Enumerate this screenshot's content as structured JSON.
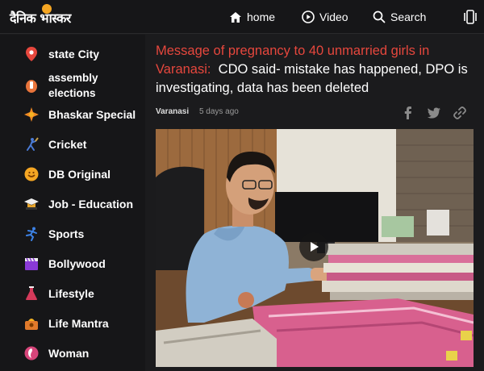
{
  "brand": {
    "logo_text": "दैनिक भास्कर"
  },
  "topnav": {
    "home": "home",
    "video": "Video",
    "search": "Search"
  },
  "sidebar": {
    "items": [
      {
        "label": "state City",
        "icon": "location-pin-icon"
      },
      {
        "label_line1": "assembly",
        "label_line2": "elections",
        "icon": "ballot-icon"
      },
      {
        "label": "Bhaskar Special",
        "icon": "star-burst-icon"
      },
      {
        "label": "Cricket",
        "icon": "cricket-player-icon"
      },
      {
        "label": "DB Original",
        "icon": "db-original-icon"
      },
      {
        "label": "Job - Education",
        "icon": "graduation-cap-icon"
      },
      {
        "label": "Sports",
        "icon": "runner-icon"
      },
      {
        "label": "Bollywood",
        "icon": "clapperboard-icon"
      },
      {
        "label": "Lifestyle",
        "icon": "flask-icon"
      },
      {
        "label": "Life Mantra",
        "icon": "life-mantra-icon"
      },
      {
        "label": "Woman",
        "icon": "woman-icon"
      }
    ]
  },
  "article": {
    "headline_red": "Message of pregnancy to 40 unmarried girls in Varanasi:",
    "headline_white": "CDO said- mistake has happened, DPO is investigating, data has been deleted",
    "city": "Varanasi",
    "time": "5 days ago"
  },
  "colors": {
    "accent_red": "#e6473d",
    "logo_orange": "#f5a623",
    "background": "#1b1b1d"
  }
}
